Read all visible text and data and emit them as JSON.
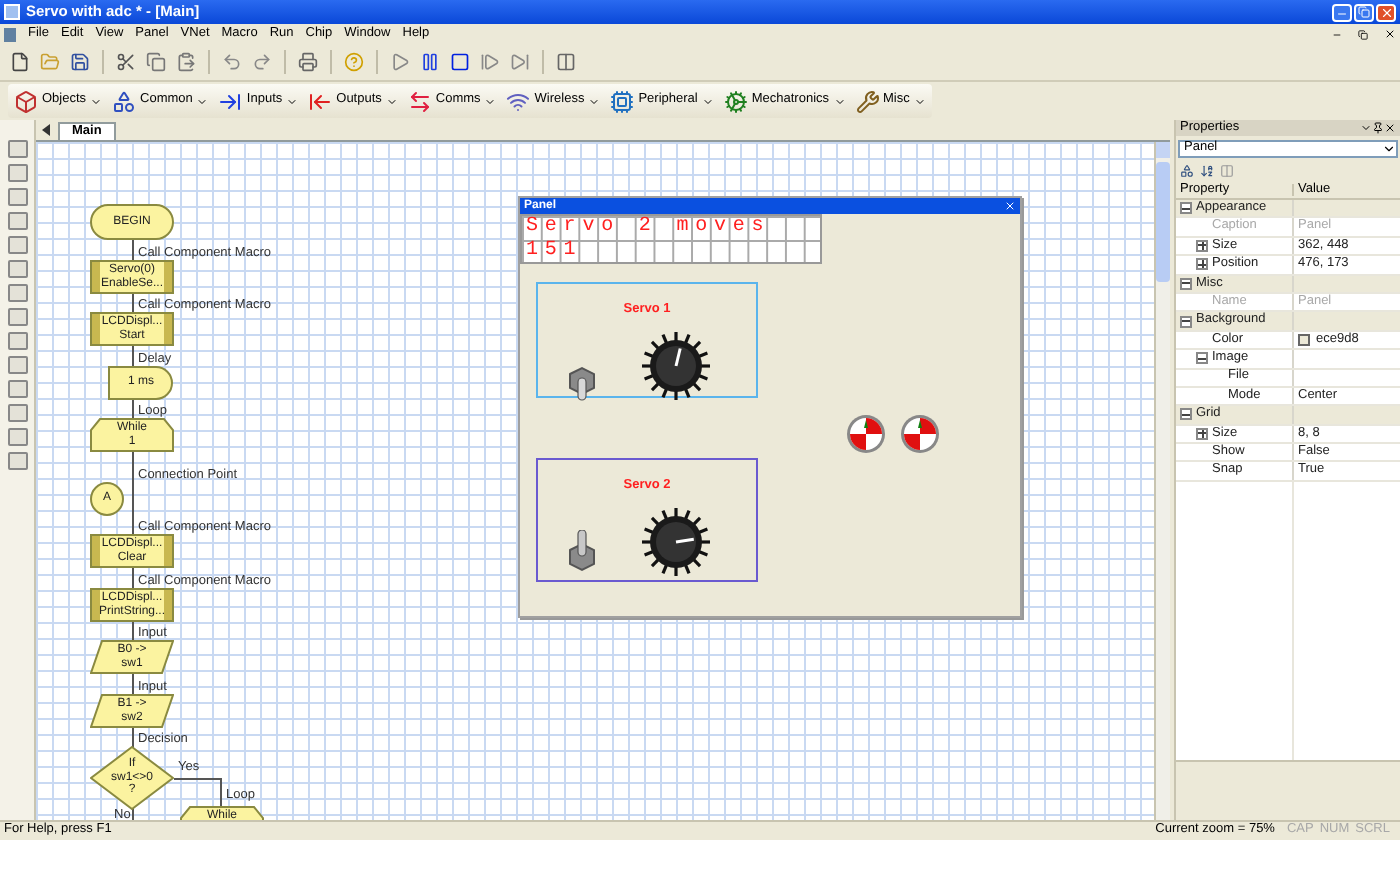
{
  "window": {
    "title": "Servo with adc * - [Main]"
  },
  "menu": [
    "File",
    "Edit",
    "View",
    "Panel",
    "VNet",
    "Macro",
    "Run",
    "Chip",
    "Window",
    "Help"
  ],
  "component_toolbar": [
    "Objects",
    "Common",
    "Inputs",
    "Outputs",
    "Comms",
    "Wireless",
    "Peripheral",
    "Mechatronics",
    "Misc"
  ],
  "tabs": [
    {
      "label": "Main",
      "selected": true
    }
  ],
  "flowchart": {
    "nodes": [
      {
        "kind": "terminal",
        "lines": [
          "BEGIN"
        ]
      },
      {
        "kind": "macro",
        "caption": "Call Component Macro",
        "lines": [
          "Servo(0)",
          "EnableSe..."
        ]
      },
      {
        "kind": "macro",
        "caption": "Call Component Macro",
        "lines": [
          "LCDDispl...",
          "Start"
        ]
      },
      {
        "kind": "delay",
        "caption": "Delay",
        "lines": [
          "1 ms"
        ]
      },
      {
        "kind": "loop",
        "caption": "Loop",
        "lines": [
          "While",
          "1"
        ]
      },
      {
        "kind": "connector",
        "caption": "Connection Point",
        "lines": [
          "A"
        ]
      },
      {
        "kind": "macro",
        "caption": "Call Component Macro",
        "lines": [
          "LCDDispl...",
          "Clear"
        ]
      },
      {
        "kind": "macro",
        "caption": "Call Component Macro",
        "lines": [
          "LCDDispl...",
          "PrintString..."
        ]
      },
      {
        "kind": "input",
        "caption": "Input",
        "lines": [
          "B0 ->",
          "sw1"
        ]
      },
      {
        "kind": "input",
        "caption": "Input",
        "lines": [
          "B1 ->",
          "sw2"
        ]
      },
      {
        "kind": "decision",
        "caption": "Decision",
        "lines": [
          "If",
          "sw1<>0",
          "?"
        ]
      }
    ],
    "branch": {
      "yes": "Yes",
      "no": "No",
      "caption": "Loop",
      "lines": [
        "While"
      ]
    }
  },
  "panel": {
    "title": "Panel",
    "lcd": [
      "Servo 2 moves",
      "151"
    ],
    "servos": [
      {
        "label": "Servo 1",
        "on": false,
        "level": 0.55
      },
      {
        "label": "Servo 2",
        "on": true,
        "level": 0.8
      }
    ]
  },
  "properties": {
    "title": "Properties",
    "object": "Panel",
    "columns": [
      "Property",
      "Value"
    ],
    "groups": [
      {
        "name": "Appearance",
        "expanded": true,
        "children": [
          {
            "name": "Caption",
            "value": "Panel",
            "disabled": true
          },
          {
            "name": "Size",
            "value": "362, 448",
            "expanded": false
          },
          {
            "name": "Position",
            "value": "476, 173",
            "expanded": false
          }
        ]
      },
      {
        "name": "Misc",
        "expanded": true,
        "children": [
          {
            "name": "Name",
            "value": "Panel",
            "disabled": true
          }
        ]
      },
      {
        "name": "Background",
        "expanded": true,
        "children": [
          {
            "name": "Color",
            "value": "ece9d8",
            "swatch": true
          },
          {
            "name": "Image",
            "expanded": true,
            "children": [
              {
                "name": "File"
              },
              {
                "name": "Mode",
                "value": "Center"
              }
            ]
          }
        ]
      },
      {
        "name": "Grid",
        "expanded": true,
        "children": [
          {
            "name": "Size",
            "value": "8, 8",
            "expanded": false
          },
          {
            "name": "Show",
            "value": "False"
          },
          {
            "name": "Snap",
            "value": "True"
          }
        ]
      }
    ]
  },
  "status_bar": {
    "help": "For Help, press F1",
    "zoom": "Current zoom = 75%",
    "indicators": [
      {
        "label": "CAP",
        "active": false
      },
      {
        "label": "NUM",
        "active": false
      },
      {
        "label": "SCRL",
        "active": false
      }
    ]
  }
}
